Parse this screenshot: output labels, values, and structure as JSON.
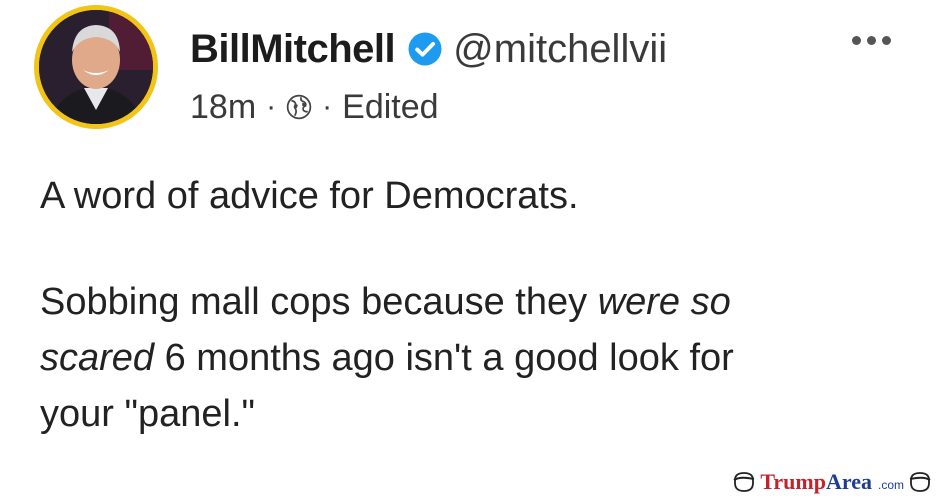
{
  "post": {
    "display_name": "BillMitchell",
    "verified": true,
    "handle": "@mitchellvii",
    "time": "18m",
    "separator": "·",
    "visibility_icon": "globe-icon",
    "edited_label": "Edited",
    "menu_icon": "more-options-icon",
    "body": {
      "line1": "A word of advice for Democrats.",
      "line2_start": "Sobbing mall cops because they ",
      "line2_italic": "were so",
      "line3_italic": "scared",
      "line3_rest": " 6 months ago isn't a good look for",
      "line4": "your \"panel.\""
    }
  },
  "watermark": {
    "part1": "Trump",
    "part2": "Area",
    "part3": ".com"
  },
  "colors": {
    "avatar_ring": "#f2c416",
    "verified_badge": "#1d9bf0",
    "watermark_red": "#c2242d",
    "watermark_blue": "#1e3f8f"
  }
}
